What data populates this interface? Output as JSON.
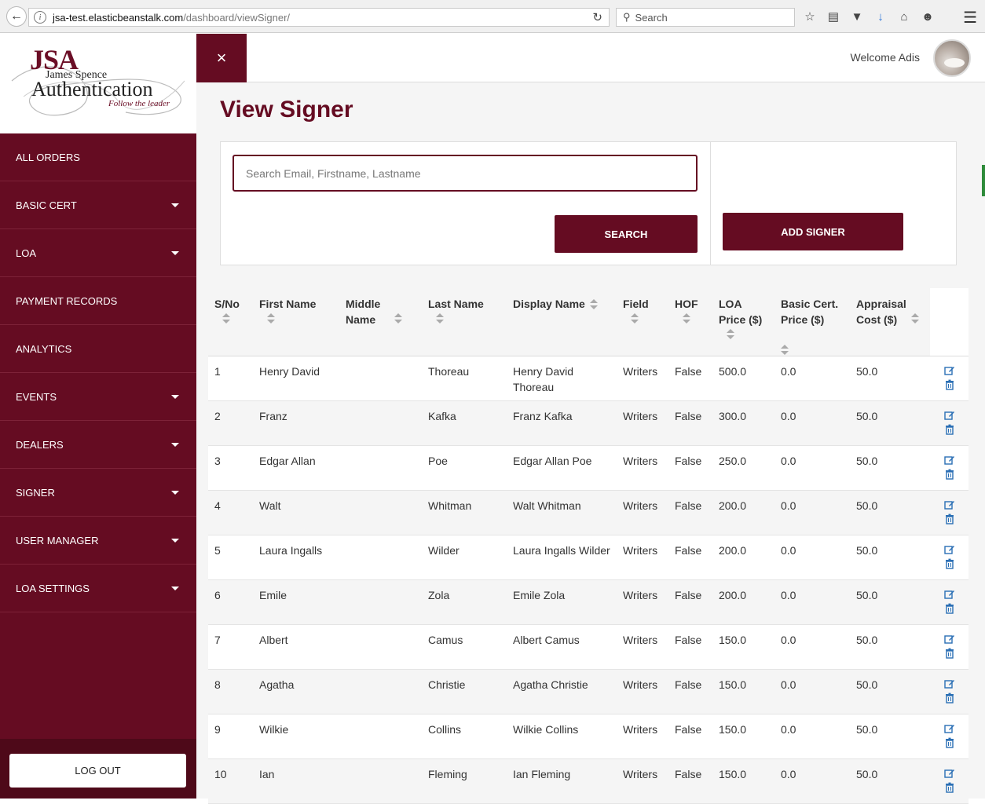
{
  "browser": {
    "url_host": "jsa-test.elasticbeanstalk.com",
    "url_path": "/dashboard/viewSigner/",
    "search_placeholder": "Search"
  },
  "logo": {
    "jsa": "JSA",
    "name": "James Spence",
    "auth": "Authentication",
    "tagline": "Follow the leader"
  },
  "sidebar": {
    "items": [
      {
        "label": "ALL ORDERS",
        "caret": false
      },
      {
        "label": "BASIC CERT",
        "caret": true
      },
      {
        "label": "LOA",
        "caret": true
      },
      {
        "label": "PAYMENT RECORDS",
        "caret": false
      },
      {
        "label": "ANALYTICS",
        "caret": false
      },
      {
        "label": "EVENTS",
        "caret": true
      },
      {
        "label": "DEALERS",
        "caret": true
      },
      {
        "label": "SIGNER",
        "caret": true
      },
      {
        "label": "USER MANAGER",
        "caret": true
      },
      {
        "label": "LOA SETTINGS",
        "caret": true
      }
    ],
    "logout_label": "LOG OUT"
  },
  "header": {
    "close_symbol": "×",
    "welcome": "Welcome Adis"
  },
  "page": {
    "title": "View Signer",
    "search_placeholder": "Search Email, Firstname, Lastname",
    "search_button": "SEARCH",
    "add_button": "ADD SIGNER"
  },
  "table": {
    "columns": [
      "S/No",
      "First Name",
      "Middle Name",
      "Last Name",
      "Display Name",
      "Field",
      "HOF",
      "LOA Price ($)",
      "Basic Cert. Price ($)",
      "Appraisal Cost ($)"
    ],
    "rows": [
      [
        "1",
        "Henry David",
        "",
        "Thoreau",
        "Henry David Thoreau",
        "Writers",
        "False",
        "500.0",
        "0.0",
        "50.0"
      ],
      [
        "2",
        "Franz",
        "",
        "Kafka",
        "Franz Kafka",
        "Writers",
        "False",
        "300.0",
        "0.0",
        "50.0"
      ],
      [
        "3",
        "Edgar Allan",
        "",
        "Poe",
        "Edgar Allan Poe",
        "Writers",
        "False",
        "250.0",
        "0.0",
        "50.0"
      ],
      [
        "4",
        "Walt",
        "",
        "Whitman",
        "Walt Whitman",
        "Writers",
        "False",
        "200.0",
        "0.0",
        "50.0"
      ],
      [
        "5",
        "Laura Ingalls",
        "",
        "Wilder",
        "Laura Ingalls Wilder",
        "Writers",
        "False",
        "200.0",
        "0.0",
        "50.0"
      ],
      [
        "6",
        "Emile",
        "",
        "Zola",
        "Emile Zola",
        "Writers",
        "False",
        "200.0",
        "0.0",
        "50.0"
      ],
      [
        "7",
        "Albert",
        "",
        "Camus",
        "Albert Camus",
        "Writers",
        "False",
        "150.0",
        "0.0",
        "50.0"
      ],
      [
        "8",
        "Agatha",
        "",
        "Christie",
        "Agatha Christie",
        "Writers",
        "False",
        "150.0",
        "0.0",
        "50.0"
      ],
      [
        "9",
        "Wilkie",
        "",
        "Collins",
        "Wilkie Collins",
        "Writers",
        "False",
        "150.0",
        "0.0",
        "50.0"
      ],
      [
        "10",
        "Ian",
        "",
        "Fleming",
        "Ian Fleming",
        "Writers",
        "False",
        "150.0",
        "0.0",
        "50.0"
      ]
    ]
  },
  "colors": {
    "brand": "#650c22",
    "action_icon": "#2a6fb5"
  }
}
